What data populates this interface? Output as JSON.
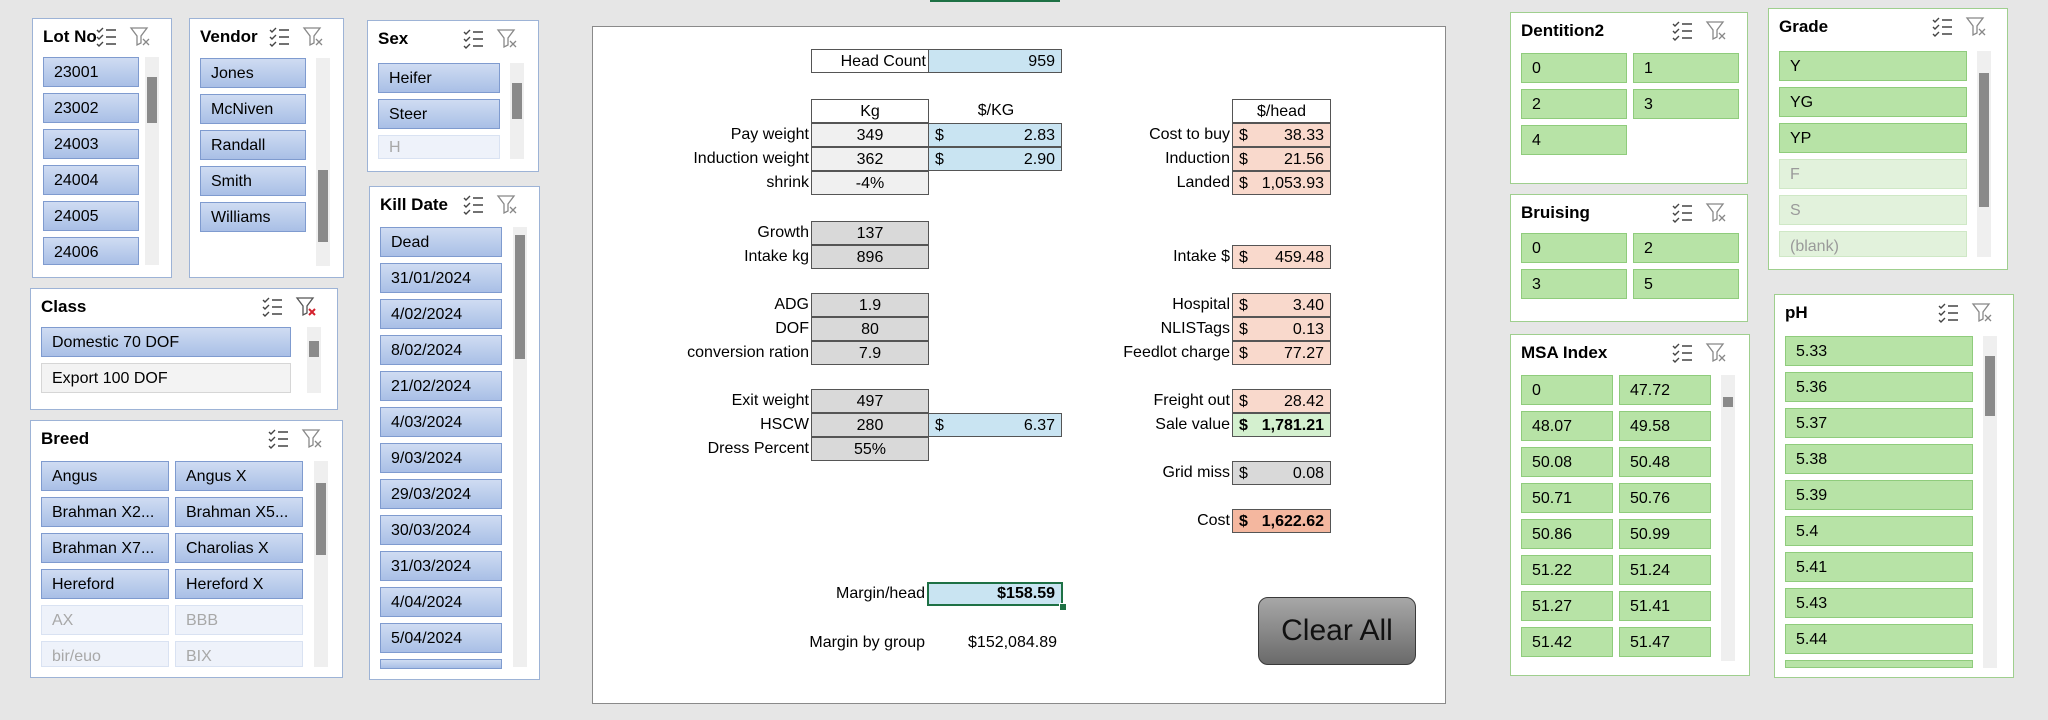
{
  "slicers": {
    "lot_no": {
      "title": "Lot No",
      "items": [
        "23001",
        "23002",
        "24003",
        "24004",
        "24005",
        "24006"
      ]
    },
    "vendor": {
      "title": "Vendor",
      "items": [
        "Jones",
        "McNiven",
        "Randall",
        "Smith",
        "Williams"
      ]
    },
    "sex": {
      "title": "Sex",
      "items": [
        "Heifer",
        "Steer",
        "H"
      ]
    },
    "kill_date": {
      "title": "Kill Date",
      "items": [
        "Dead",
        "31/01/2024",
        "4/02/2024",
        "8/02/2024",
        "21/02/2024",
        "4/03/2024",
        "9/03/2024",
        "29/03/2024",
        "30/03/2024",
        "31/03/2024",
        "4/04/2024",
        "5/04/2024"
      ]
    },
    "class": {
      "title": "Class",
      "items": [
        "Domestic 70 DOF",
        "Export 100 DOF"
      ]
    },
    "breed": {
      "title": "Breed",
      "items": [
        "Angus",
        "Angus X",
        "Brahman X2...",
        "Brahman X5...",
        "Brahman X7...",
        "Charolias X",
        "Hereford",
        "Hereford X",
        "AX",
        "BBB",
        "bir/euo",
        "BIX"
      ]
    },
    "dentition2": {
      "title": "Dentition2",
      "items": [
        "0",
        "1",
        "2",
        "3",
        "4"
      ]
    },
    "bruising": {
      "title": "Bruising",
      "items": [
        "0",
        "2",
        "3",
        "5"
      ]
    },
    "msa_index": {
      "title": "MSA Index",
      "items": [
        "0",
        "47.72",
        "48.07",
        "49.58",
        "50.08",
        "50.48",
        "50.71",
        "50.76",
        "50.86",
        "50.99",
        "51.22",
        "51.24",
        "51.27",
        "51.41",
        "51.42",
        "51.47"
      ]
    },
    "grade": {
      "title": "Grade",
      "items": [
        "Y",
        "YG",
        "YP",
        "F",
        "S",
        "(blank)"
      ]
    },
    "ph": {
      "title": "pH",
      "items": [
        "5.33",
        "5.36",
        "5.37",
        "5.38",
        "5.39",
        "5.4",
        "5.41",
        "5.43",
        "5.44"
      ]
    }
  },
  "sheet": {
    "head_count_label": "Head Count",
    "head_count": "959",
    "col_kg": "Kg",
    "col_per_kg": "$/KG",
    "col_per_head": "$/head",
    "pay_weight_label": "Pay weight",
    "pay_weight": "349",
    "pay_weight_rate": "2.83",
    "induction_weight_label": "Induction weight",
    "induction_weight": "362",
    "induction_weight_rate": "2.90",
    "shrink_label": "shrink",
    "shrink": "-4%",
    "growth_label": "Growth",
    "growth": "137",
    "intake_kg_label": "Intake kg",
    "intake_kg": "896",
    "adg_label": "ADG",
    "adg": "1.9",
    "dof_label": "DOF",
    "dof": "80",
    "conversion_label": "conversion ration",
    "conversion": "7.9",
    "exit_weight_label": "Exit weight",
    "exit_weight": "497",
    "hscw_label": "HSCW",
    "hscw": "280",
    "hscw_rate": "6.37",
    "dress_label": "Dress Percent",
    "dress": "55%",
    "currency": "$",
    "cost_to_buy_label": "Cost to buy",
    "cost_to_buy": "38.33",
    "induction_label": "Induction",
    "induction": "21.56",
    "landed_label": "Landed",
    "landed": "1,053.93",
    "intake_label": "Intake $",
    "intake": "459.48",
    "hospital_label": "Hospital",
    "hospital": "3.40",
    "nlis_label": "NLISTags",
    "nlis": "0.13",
    "feedlot_label": "Feedlot charge",
    "feedlot": "77.27",
    "freight_label": "Freight out",
    "freight": "28.42",
    "sale_label": "Sale value",
    "sale": "1,781.21",
    "grid_label": "Grid miss",
    "grid": "0.08",
    "cost_label": "Cost",
    "cost": "1,622.62",
    "margin_head_label": "Margin/head",
    "margin_head": "$158.59",
    "margin_group_label": "Margin by group",
    "margin_group": "$152,084.89"
  },
  "clear_all": "Clear All"
}
